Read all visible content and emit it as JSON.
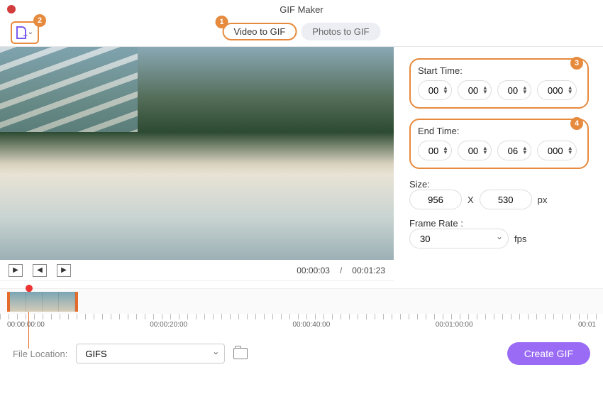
{
  "window": {
    "title": "GIF Maker"
  },
  "callouts": {
    "c1": "1",
    "c2": "2",
    "c3": "3",
    "c4": "4"
  },
  "tabs": {
    "video": "Video to GIF",
    "photos": "Photos to GIF"
  },
  "player": {
    "current": "00:00:03",
    "sep": "/",
    "duration": "00:01:23"
  },
  "panel": {
    "start_label": "Start Time:",
    "end_label": "End Time:",
    "start": {
      "h": "00",
      "m": "00",
      "s": "00",
      "ms": "000"
    },
    "end": {
      "h": "00",
      "m": "00",
      "s": "06",
      "ms": "000"
    },
    "size_label": "Size:",
    "size_w": "956",
    "size_x": "X",
    "size_h": "530",
    "size_unit": "px",
    "fr_label": "Frame Rate :",
    "fr_value": "30",
    "fr_unit": "fps"
  },
  "ruler": {
    "t0": "00:00:00:00",
    "t1": "00:00:20:00",
    "t2": "00:00:40:00",
    "t3": "00:01:00:00",
    "t4": "00:01"
  },
  "bottom": {
    "loc_label": "File Location:",
    "loc_value": "GIFS",
    "create": "Create GIF"
  }
}
